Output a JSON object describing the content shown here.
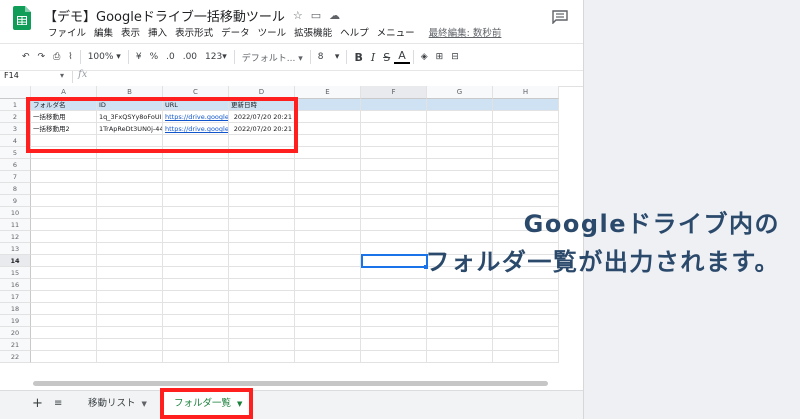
{
  "app": {
    "title": "【デモ】Googleドライブ一括移動ツール",
    "menu": [
      "ファイル",
      "編集",
      "表示",
      "挿入",
      "表示形式",
      "データ",
      "ツール",
      "拡張機能",
      "ヘルプ",
      "メニュー"
    ],
    "last_edit": "最終編集: 数秒前",
    "colors": {
      "accent": "#1a73e8",
      "highlight": "#ff1f1f",
      "header_fill": "#cfe2f3",
      "link": "#1155cc",
      "sheets_green": "#0f9d58"
    }
  },
  "toolbar": {
    "undo_icon": "undo-icon",
    "redo_icon": "redo-icon",
    "print_icon": "print-icon",
    "paint_icon": "paint-format-icon",
    "zoom": "100%",
    "currency": "¥",
    "percent": "%",
    "decimal_dec": ".0",
    "decimal_inc": ".00",
    "more_formats": "123",
    "font": "デフォルト...",
    "font_size": "8",
    "bold": "B",
    "italic": "I",
    "strike": "S",
    "text_color": "A"
  },
  "formula_bar": {
    "name_box": "F14",
    "fx": "fx",
    "value": ""
  },
  "grid": {
    "columns": [
      "A",
      "B",
      "C",
      "D",
      "E",
      "F",
      "G",
      "H"
    ],
    "rows": [
      "1",
      "2",
      "3",
      "4",
      "5",
      "6",
      "7",
      "8",
      "9",
      "10",
      "11",
      "12",
      "13",
      "14",
      "15",
      "16",
      "17",
      "18",
      "19",
      "20",
      "21",
      "22"
    ],
    "selected_cell": "F14",
    "header": [
      "フォルダ名",
      "ID",
      "URL",
      "更新日時"
    ],
    "data": [
      [
        "一括移動用",
        "1q_3FxQSYy8oFoUI",
        "https://drive.google.c",
        "2022/07/20 20:21"
      ],
      [
        "一括移動用2",
        "1TrApReDt3UN0j-44",
        "https://drive.google.c",
        "2022/07/20 20:21"
      ]
    ]
  },
  "sheets": {
    "add_icon": "+",
    "list_icon": "≡",
    "tabs": [
      {
        "label": "移動リスト",
        "active": false
      },
      {
        "label": "フォルダ一覧",
        "active": true
      }
    ]
  },
  "overlay": {
    "line1": "Googleドライブ内の",
    "line2": "フォルダ一覧が出力されます。"
  }
}
